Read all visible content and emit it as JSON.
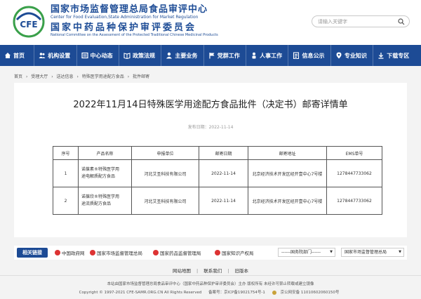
{
  "header": {
    "logo_text": "CFE",
    "org_cn_1": "国家市场监督管理总局食品审评中心",
    "org_en_1": "Center for Food Evaluation,State Administration for Market Regulation",
    "org_cn_2": "国家中药品种保护审评委员会",
    "org_en_2": "National Committee on the Assessment of the Protected Traditional Chinese Medicinal Products",
    "search_placeholder": "请输入关键字"
  },
  "nav": [
    {
      "label": "首页",
      "icon": "home-icon"
    },
    {
      "label": "机构设置",
      "icon": "people-icon"
    },
    {
      "label": "中心动态",
      "icon": "news-icon"
    },
    {
      "label": "政策法规",
      "icon": "book-icon"
    },
    {
      "label": "主要业务",
      "icon": "user-icon"
    },
    {
      "label": "党群工作",
      "icon": "flag-icon"
    },
    {
      "label": "人事工作",
      "icon": "person-icon"
    },
    {
      "label": "信息公示",
      "icon": "info-icon"
    },
    {
      "label": "专业知识",
      "icon": "pin-icon"
    },
    {
      "label": "下载专区",
      "icon": "download-icon"
    }
  ],
  "breadcrumb": [
    "首页",
    "›",
    "受理大厅",
    "›",
    "送达信息",
    "›",
    "特殊医学用途配方食品",
    "›",
    "批件邮寄"
  ],
  "article": {
    "title": "2022年11月14日特殊医学用途配方食品批件（决定书）邮寄详情单",
    "publish_time": "发布日期：2022-11-14"
  },
  "table": {
    "headers": [
      "序号",
      "产品名称",
      "申报单位",
      "邮寄日期",
      "邮寄地址",
      "EMS单号"
    ],
    "rows": [
      {
        "no": "1",
        "name_line1": "诺葆素®特殊医学用",
        "name_line2": "途电解质配方食品",
        "company": "河北艾圣科技有限公司",
        "date": "2022-11-14",
        "address": "北京经济技术开发区经开壹中心7号楼",
        "ems": "1278447733062"
      },
      {
        "no": "2",
        "name_line1": "诺葆欣®特殊医学用",
        "name_line2": "途流质配方食品",
        "company": "河北艾圣科技有限公司",
        "date": "2022-11-14",
        "address": "北京经济技术开发区经开壹中心7号楼",
        "ems": "1278447733062"
      }
    ]
  },
  "links": {
    "label": "相关链接",
    "items": [
      "中国政府网",
      "国家市场监督管理总局",
      "国家药品监督管理局",
      "国家知识产权局"
    ],
    "select1": "------国务院部门------",
    "select2": "国家市场监督管理总局"
  },
  "footer": {
    "links": [
      "网站地图",
      "联系我们",
      "旧版本"
    ],
    "line1": "本站由国家市场监督管理总局食品审评中心（国家中药品种保护审评委员会）主办 版权所有 未经许可禁止转载或建立镜像",
    "copyright": "Copyright © 1997-2021 CFE-SAMR.ORG.CN All Rights Reserved",
    "icp": "备案号：京ICP备19021754号-1",
    "police": "京公网安备 11010602060150号"
  },
  "colors": {
    "brand": "#1d4b95",
    "background": "#f3f3f3"
  }
}
